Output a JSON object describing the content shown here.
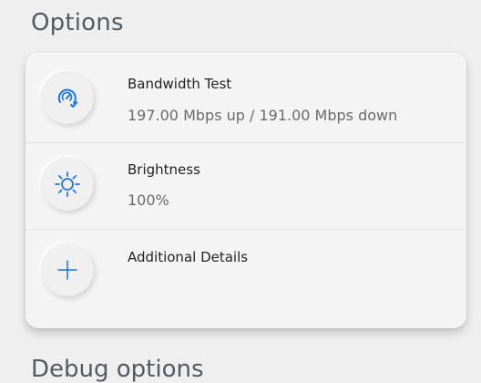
{
  "page": {
    "title": "Options",
    "next_section_title": "Debug options"
  },
  "colors": {
    "accent": "#1a73e8",
    "background": "#efefef",
    "card": "#f4f4f4"
  },
  "options": [
    {
      "icon": "speedometer-icon",
      "title": "Bandwidth Test",
      "value": "197.00 Mbps up / 191.00 Mbps down"
    },
    {
      "icon": "brightness-icon",
      "title": "Brightness",
      "value": "100%"
    },
    {
      "icon": "plus-icon",
      "title": "Additional Details"
    }
  ]
}
